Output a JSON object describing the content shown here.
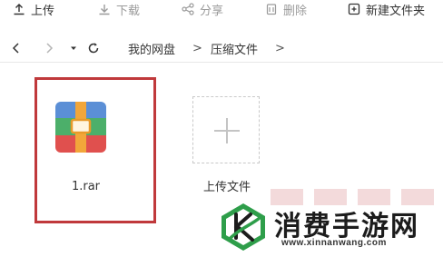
{
  "toolbar": {
    "upload_label": "上传",
    "download_label": "下载",
    "share_label": "分享",
    "delete_label": "删除",
    "new_folder_label": "新建文件夹"
  },
  "nav": {
    "breadcrumbs": [
      "我的网盘",
      "压缩文件"
    ],
    "separator": ">"
  },
  "files": [
    {
      "name": "1.rar",
      "type": "rar-archive",
      "selected": true
    }
  ],
  "upload_tile": {
    "label": "上传文件"
  },
  "watermark": {
    "title": "消费手游网",
    "url": "www.xinnanwang.com"
  },
  "colors": {
    "selection_border": "#c0393b",
    "rar_blue": "#5b8fd6",
    "rar_green": "#4caf6a",
    "rar_red": "#e0504e",
    "rar_orange": "#f2a63a",
    "logo_green": "#2e9e4a"
  }
}
